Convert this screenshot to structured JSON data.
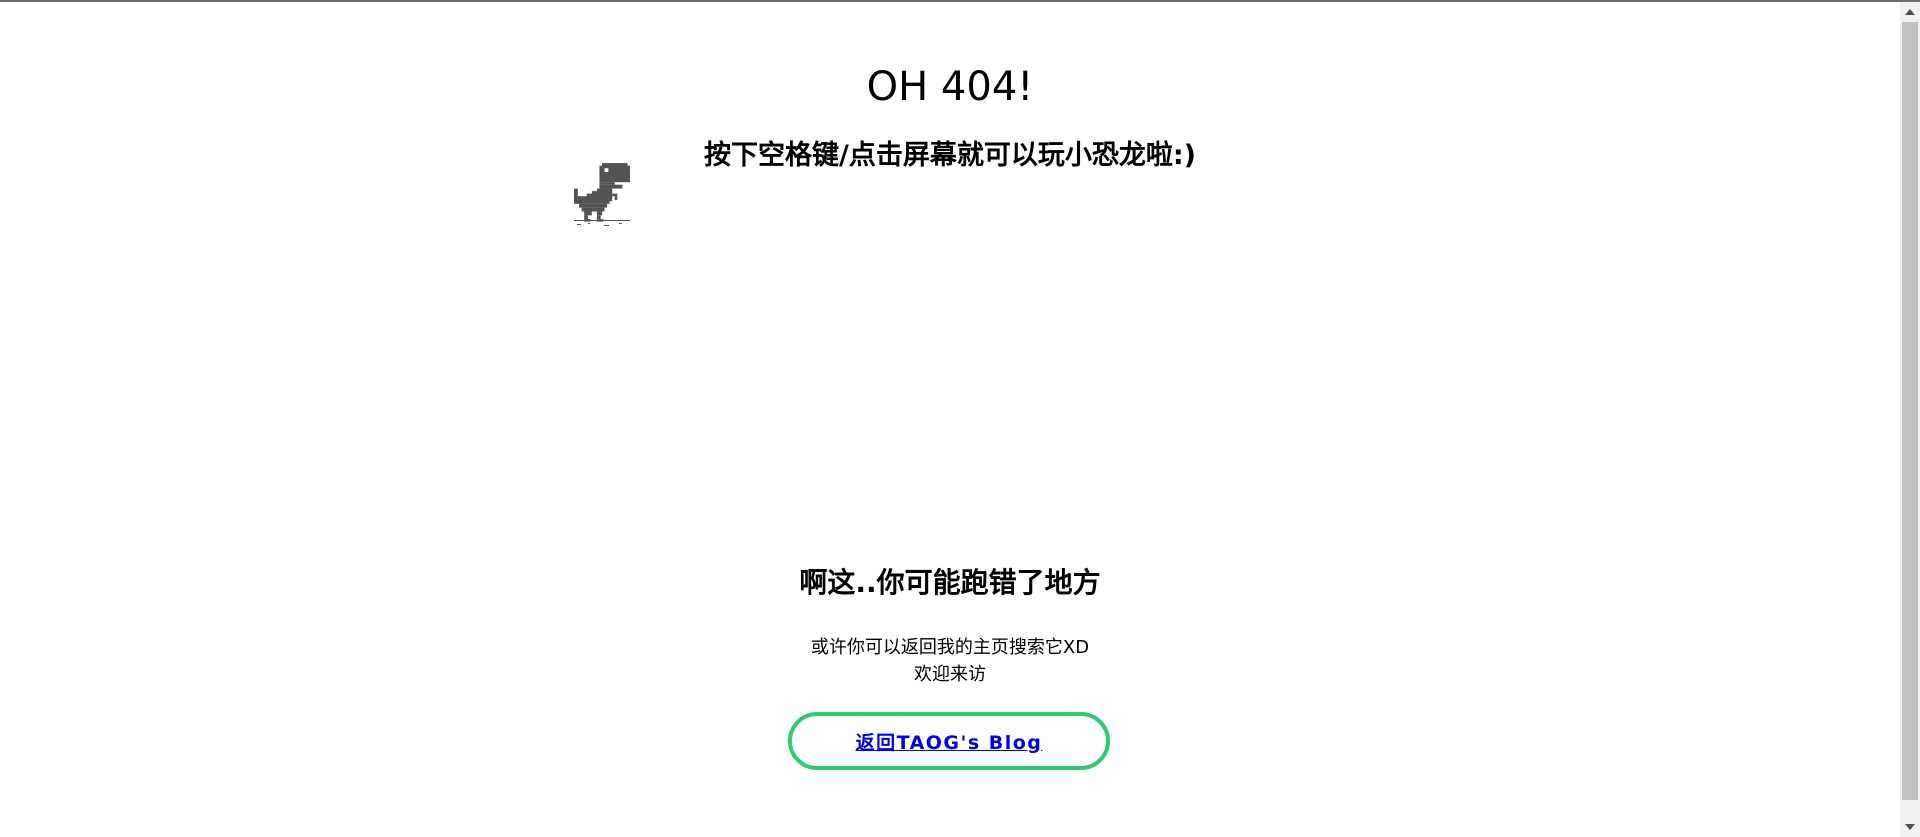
{
  "header": {
    "title": "OH 404!",
    "subtitle": "按下空格键/点击屏幕就可以玩小恐龙啦:)"
  },
  "game": {
    "character": "t-rex-dino-icon",
    "color": "#535353"
  },
  "main": {
    "message": "啊这..你可能跑错了地方",
    "hint_line1": "或许你可以返回我的主页搜索它XD",
    "hint_line2": "欢迎来访"
  },
  "back_button": {
    "label": "返回TAOG's Blog",
    "border_color": "#2ecc71",
    "link_color": "#0000ee"
  }
}
